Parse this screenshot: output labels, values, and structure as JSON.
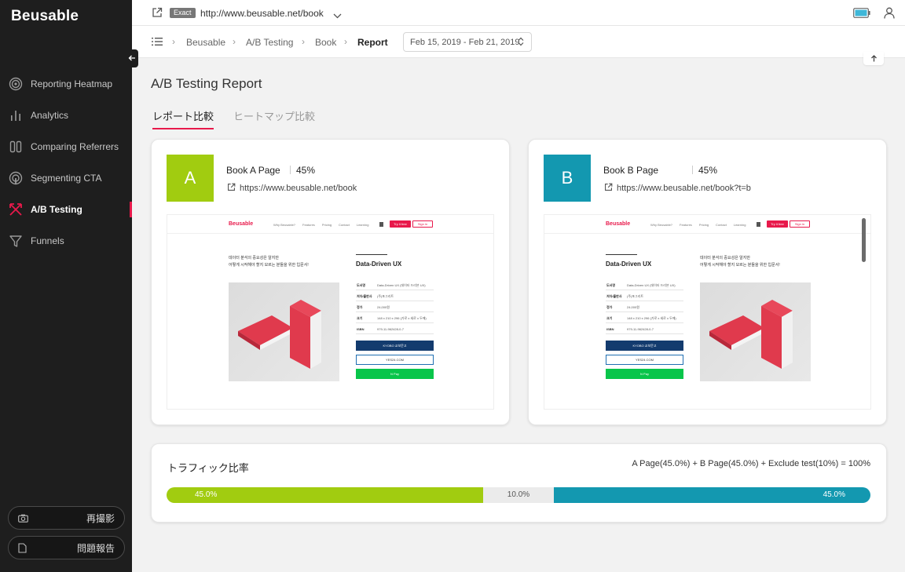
{
  "app": {
    "logo": "Beusable"
  },
  "sidebar": {
    "items": [
      {
        "label": "Reporting Heatmap",
        "icon": "target-icon"
      },
      {
        "label": "Analytics",
        "icon": "bar-chart-icon"
      },
      {
        "label": "Comparing Referrers",
        "icon": "columns-icon"
      },
      {
        "label": "Segmenting CTA",
        "icon": "touch-icon"
      },
      {
        "label": "A/B Testing",
        "icon": "split-arrows-icon",
        "active": true
      },
      {
        "label": "Funnels",
        "icon": "funnel-icon"
      }
    ],
    "recapture_label": "再撮影",
    "report_issue_label": "問題報告"
  },
  "topbar": {
    "match_badge": "Exact",
    "url": "http://www.beusable.net/book"
  },
  "breadcrumb": {
    "items": [
      "Beusable",
      "A/B Testing",
      "Book"
    ],
    "current": "Report",
    "date_range": "Feb 15, 2019 - Feb 21, 2019"
  },
  "page": {
    "title": "A/B Testing Report",
    "tabs": [
      {
        "label": "レポート比較",
        "active": true
      },
      {
        "label": "ヒートマップ比較",
        "active": false
      }
    ]
  },
  "variants": [
    {
      "letter": "A",
      "name": "Book A Page",
      "share": "45%",
      "url": "https://www.beusable.net/book",
      "color": "#a1cc10"
    },
    {
      "letter": "B",
      "name": "Book B Page",
      "share": "45%",
      "url": "https://www.beusable.net/book?t=b",
      "color": "#1398b0"
    }
  ],
  "preview": {
    "logo": "Beusable",
    "nav_links": [
      "Why Beusable?",
      "Features",
      "Pricing",
      "Contact",
      "Learning"
    ],
    "try_label": "Try it free",
    "signin_label": "Sign in",
    "desc_line1": "데이터 분석의 중요성은 알지만",
    "desc_line2": "어떻게 시작해야 할지 모르는 분들을 위한 입문서!",
    "book_title": "Data-Driven UX",
    "rows": [
      {
        "k": "도서명",
        "v": "Data-Driven UX (데이터 드리븐 UX)"
      },
      {
        "k": "저자/출판사",
        "v": "(주)포그리트"
      },
      {
        "k": "정가",
        "v": "24,000원"
      },
      {
        "k": "크기",
        "v": "148 x 210 x 296 (가로 x 세로 x 두께)"
      },
      {
        "k": "ISBN",
        "v": "979-11-962428-0-7"
      }
    ],
    "buy1": "KYOBO 교보문고",
    "buy2": "YES24.COM",
    "buy3": "N Pay"
  },
  "traffic": {
    "title": "トラフィック比率",
    "formula": "A Page(45.0%) + B Page(45.0%) + Exclude test(10%) = 100%",
    "a_label": "45.0%",
    "exclude_label": "10.0%",
    "b_label": "45.0%",
    "a_share": 0.45,
    "exclude_share": 0.1,
    "b_share": 0.45
  },
  "colors": {
    "accent": "#e8194b",
    "variant_a": "#a1cc10",
    "variant_b": "#1398b0",
    "sidebar_bg": "#1e1e1e"
  }
}
